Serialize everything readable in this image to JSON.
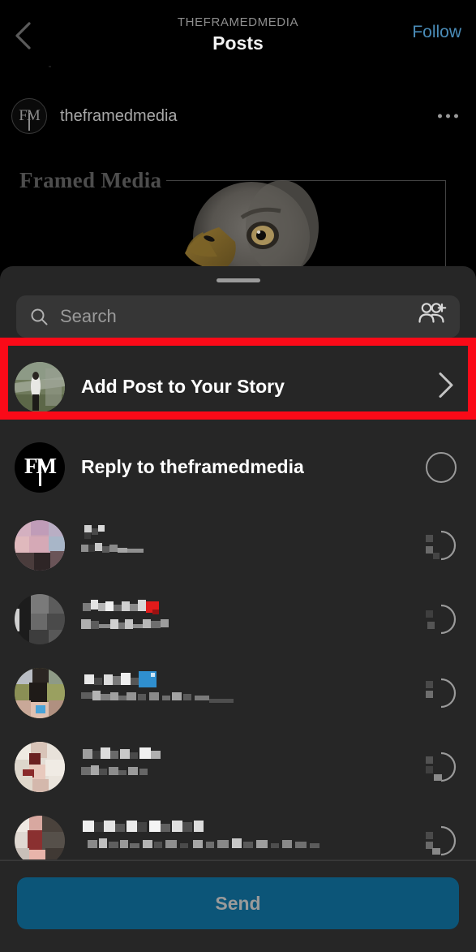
{
  "header": {
    "back_icon": "chevron-left-icon",
    "eyebrow": "THEFRAMEDMEDIA",
    "title": "Posts",
    "follow_label": "Follow",
    "follow_color": "#4a8cb8"
  },
  "post": {
    "avatar_initials": "FM",
    "username": "theframedmedia",
    "more_icon": "more-options-icon",
    "media": {
      "wordmark": "Framed Media",
      "subject": "bald-eagle-head-photo"
    }
  },
  "sheet": {
    "handle": "drag-handle",
    "search": {
      "placeholder": "Search",
      "value": "",
      "icon": "search-icon",
      "add_people_icon": "add-people-icon"
    },
    "story_row": {
      "label": "Add Post to Your Story",
      "avatar": "user-photo-avatar",
      "chevron": "chevron-right-icon"
    },
    "reply_row": {
      "label": "Reply to theframedmedia",
      "avatar_initials": "FM",
      "select_state": "unchecked"
    },
    "contacts": [
      {
        "name": "",
        "subtitle": "",
        "avatar_tint": "#c9a2b4",
        "censored": true,
        "select_state": "unchecked"
      },
      {
        "name": "",
        "subtitle": "",
        "avatar_tint": "#6a6a6a",
        "censored": true,
        "select_state": "unchecked"
      },
      {
        "name": "",
        "subtitle": "",
        "avatar_tint": "#8a8f55",
        "censored": true,
        "select_state": "unchecked"
      },
      {
        "name": "",
        "subtitle": "",
        "avatar_tint": "#d8cfc6",
        "censored": true,
        "select_state": "unchecked"
      },
      {
        "name": "",
        "subtitle": "",
        "avatar_tint": "#b08a80",
        "censored": true,
        "select_state": "unchecked"
      }
    ],
    "send_button": {
      "label": "Send",
      "enabled": false,
      "background": "#0c5578",
      "text_color": "#9a9a9a"
    }
  },
  "annotation": {
    "highlight_color": "#fa0a18",
    "highlight_target": "Add Post to Your Story"
  }
}
